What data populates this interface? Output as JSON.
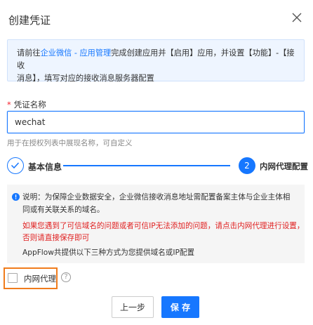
{
  "dialog": {
    "title": "创建凭证",
    "close_icon": "close-icon"
  },
  "notice": {
    "prefix": "请前往",
    "link": "企业微信 - 应用管理",
    "line1_rest": "完成创建应用并【启用】应用，并设置【功能】-【接收",
    "line2": "消息】，填写对应的接收消息服务器配置"
  },
  "credential": {
    "required_mark": "*",
    "label": "凭证名称",
    "value": "wechat",
    "help": "用于在授权列表中展现名称，可自定义"
  },
  "steps": {
    "step1": {
      "icon": "check-icon",
      "label": "基本信息"
    },
    "step2": {
      "number": "2",
      "label": "内网代理配置"
    }
  },
  "info": {
    "icon": "info-icon",
    "line1": "说明：为保障企业数据安全，企业微信接收消息地址需配置备案主体与企业主体相",
    "line2": "同或有关联关系的域名。",
    "red_line1": "如果您遇到了可信域名的问题或者可信IP无法添加的问题，请点击内网代理进行设置，",
    "red_line2": "否则请直接保存即可",
    "line3": "AppFlow共提供以下三种方式为您提供域名或IP配置"
  },
  "proxy": {
    "label": "内网代理",
    "checked": false,
    "help_icon": "question-circle-icon",
    "help_glyph": "?"
  },
  "buttons": {
    "prev": "上一步",
    "save": "保 存"
  },
  "colors": {
    "primary": "#1677ff",
    "warning_red": "#e02020",
    "highlight_orange": "#f07c1c"
  }
}
